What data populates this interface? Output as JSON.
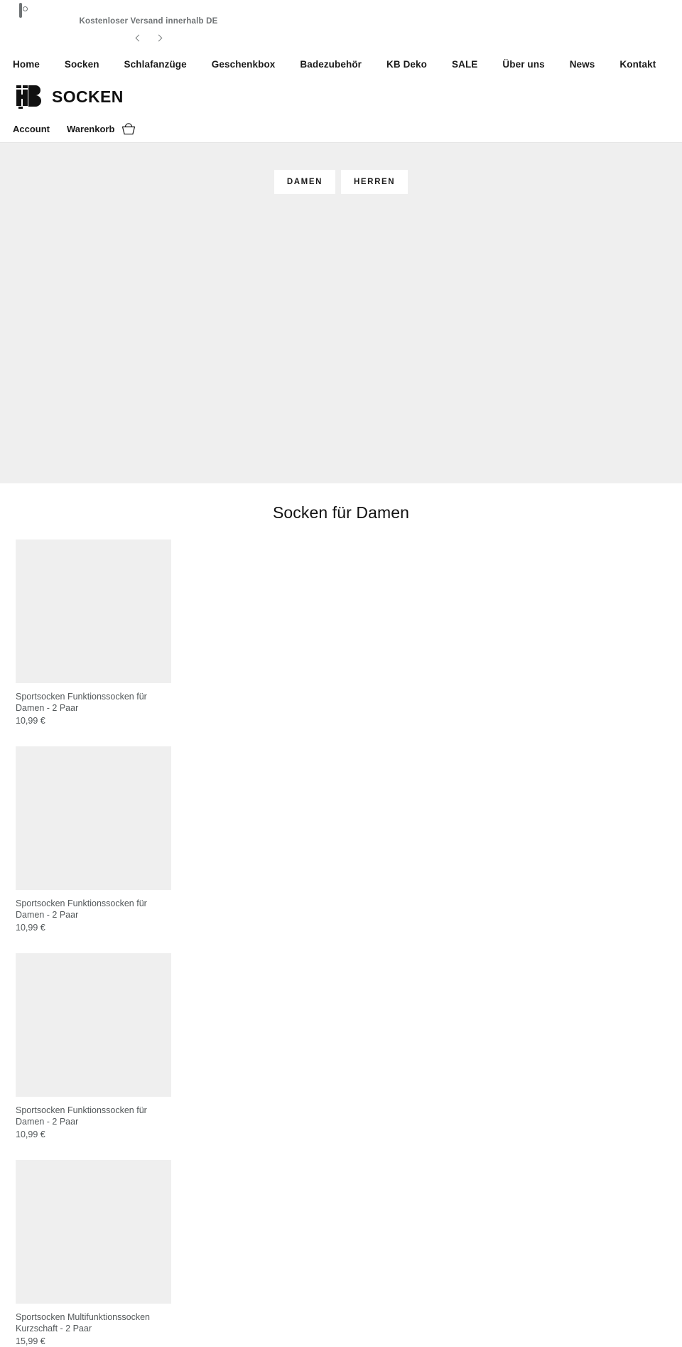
{
  "topbar": {
    "social": [
      {
        "name": "facebook-icon",
        "label": "Facebook"
      },
      {
        "name": "instagram-icon",
        "label": "Instagram"
      }
    ],
    "announcement": "Kostenloser Versand innerhalb DE",
    "prev_label": "Vorherige",
    "next_label": "Nächste"
  },
  "nav": {
    "items": [
      {
        "label": "Home"
      },
      {
        "label": "Socken"
      },
      {
        "label": "Schlafanzüge"
      },
      {
        "label": "Geschenkbox"
      },
      {
        "label": "Badezubehör"
      },
      {
        "label": "KB Deko"
      },
      {
        "label": "SALE"
      },
      {
        "label": "Über uns"
      },
      {
        "label": "News"
      },
      {
        "label": "Kontakt"
      }
    ]
  },
  "logo": {
    "mark": "HB",
    "word": "SOCKEN"
  },
  "account": {
    "account_label": "Account",
    "cart_label": "Warenkorb",
    "cart_icon": "shopping-basket-icon"
  },
  "hero": {
    "buttons": [
      {
        "label": "DAMEN"
      },
      {
        "label": "HERREN"
      }
    ]
  },
  "collection": {
    "title": "Socken für Damen",
    "products": [
      {
        "title": "Sportsocken Funktionssocken für Damen - 2 Paar",
        "price": "10,99 €"
      },
      {
        "title": "Sportsocken Funktionssocken für Damen - 2 Paar",
        "price": "10,99 €"
      },
      {
        "title": "Sportsocken Funktionssocken für Damen - 2 Paar",
        "price": "10,99 €"
      },
      {
        "title": "Sportsocken Multifunktionssocken Kurzschaft - 2 Paar",
        "price": "15,99 €"
      }
    ]
  },
  "colors": {
    "page_bg": "#ffffff",
    "placeholder_gray": "#efefef",
    "text_dark": "#1a1a1a",
    "text_muted": "#53585a",
    "announce_gray": "#6e7274"
  }
}
